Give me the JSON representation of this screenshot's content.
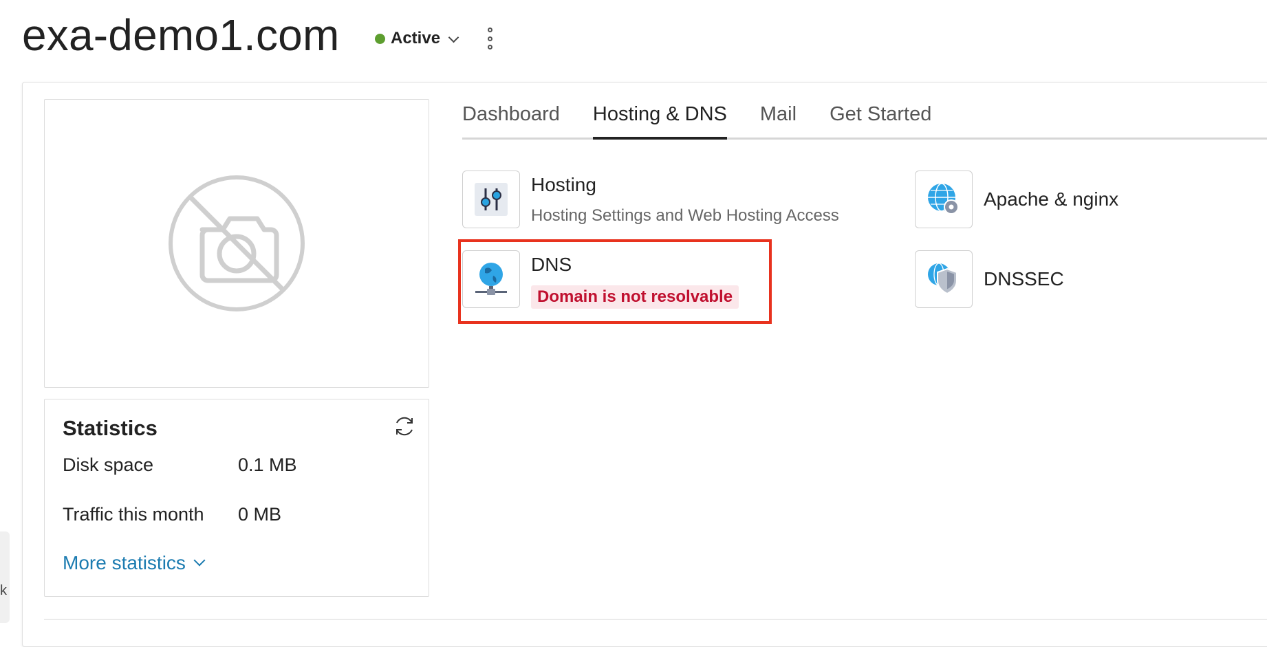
{
  "header": {
    "domain": "exa-demo1.com",
    "status": "Active",
    "status_color": "#5d9e2f"
  },
  "tabs": [
    {
      "label": "Dashboard",
      "active": false
    },
    {
      "label": "Hosting & DNS",
      "active": true
    },
    {
      "label": "Mail",
      "active": false
    },
    {
      "label": "Get Started",
      "active": false
    }
  ],
  "tiles": {
    "hosting": {
      "title": "Hosting",
      "description": "Hosting Settings and Web Hosting Access",
      "icon": "sliders-icon"
    },
    "apache": {
      "title": "Apache & nginx",
      "icon": "globe-gear-icon"
    },
    "dns": {
      "title": "DNS",
      "status": "Domain is not resolvable",
      "icon": "globe-network-icon"
    },
    "dnssec": {
      "title": "DNSSEC",
      "icon": "globe-shield-icon"
    }
  },
  "statistics": {
    "title": "Statistics",
    "rows": [
      {
        "label": "Disk space",
        "value": "0.1 MB"
      },
      {
        "label": "Traffic this month",
        "value": "0 MB"
      }
    ],
    "more_link": "More statistics"
  },
  "side_handle_glyph": "k",
  "colors": {
    "accent_link": "#1b7bb0",
    "error": "#c0102f",
    "highlight": "#e8321e"
  }
}
